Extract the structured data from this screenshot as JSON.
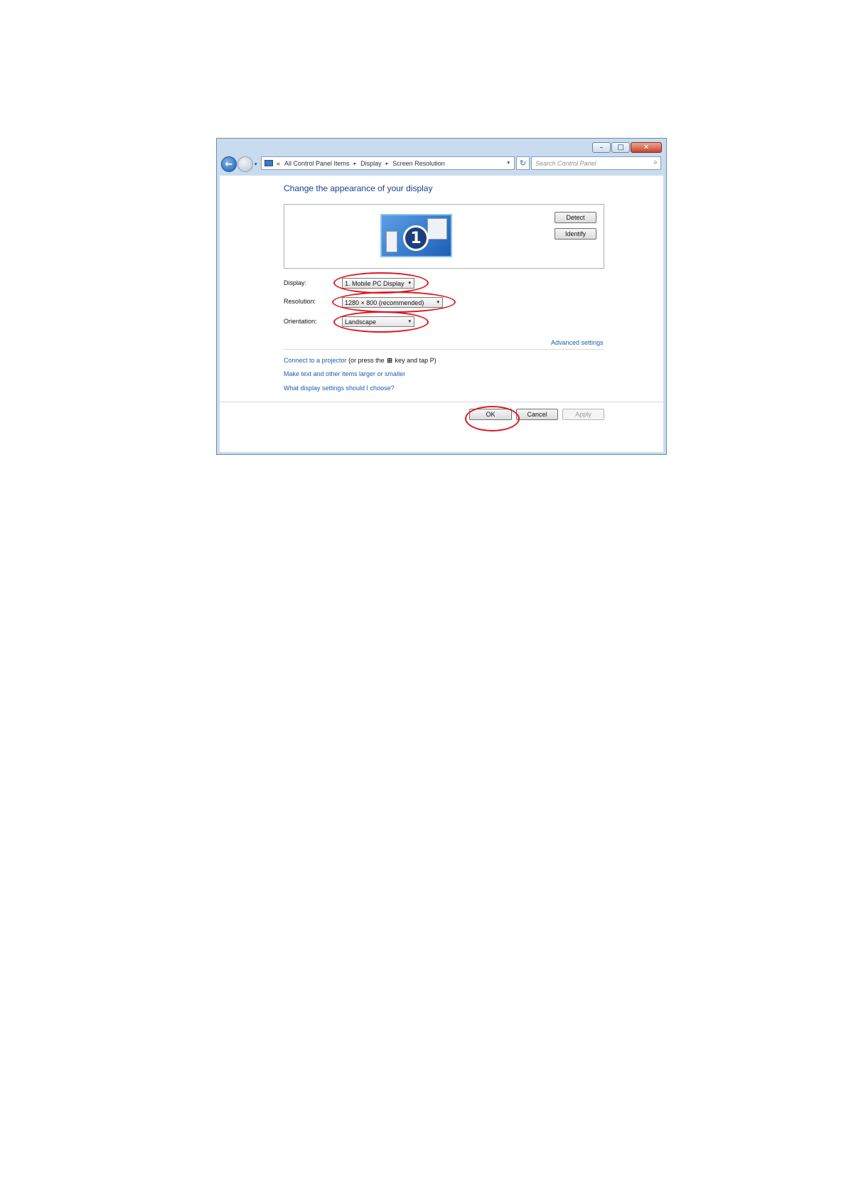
{
  "window": {
    "caption": {
      "minimize": "–",
      "maximize": "□",
      "close": "✕"
    }
  },
  "nav": {
    "back_icon": "back-arrow-icon",
    "address": {
      "prefix": "«",
      "crumbs": [
        "All Control Panel Items",
        "Display",
        "Screen Resolution"
      ],
      "separator": "▸",
      "dropdown": "▾"
    },
    "refresh_icon": "↻",
    "search": {
      "placeholder": "Search Control Panel",
      "icon": "⌕"
    }
  },
  "main": {
    "heading": "Change the appearance of your display",
    "monitor_number": "1",
    "detect_label": "Detect",
    "identify_label": "Identify",
    "display_label": "Display:",
    "display_value": "1. Mobile PC Display",
    "resolution_label": "Resolution:",
    "resolution_value": "1280 × 800 (recommended)",
    "orientation_label": "Orientation:",
    "orientation_value": "Landscape",
    "combo_arrow": "▾",
    "advanced_link": "Advanced settings",
    "projector_link": "Connect to a projector",
    "projector_text_a": " (or press the ",
    "projector_key": "⊞",
    "projector_text_b": " key and tap P)",
    "text_size_link": "Make text and other items larger or smaller",
    "help_link": "What display settings should I choose?"
  },
  "footer": {
    "ok_label": "OK",
    "cancel_label": "Cancel",
    "apply_label": "Apply"
  },
  "annotation_color": "#e0161e"
}
